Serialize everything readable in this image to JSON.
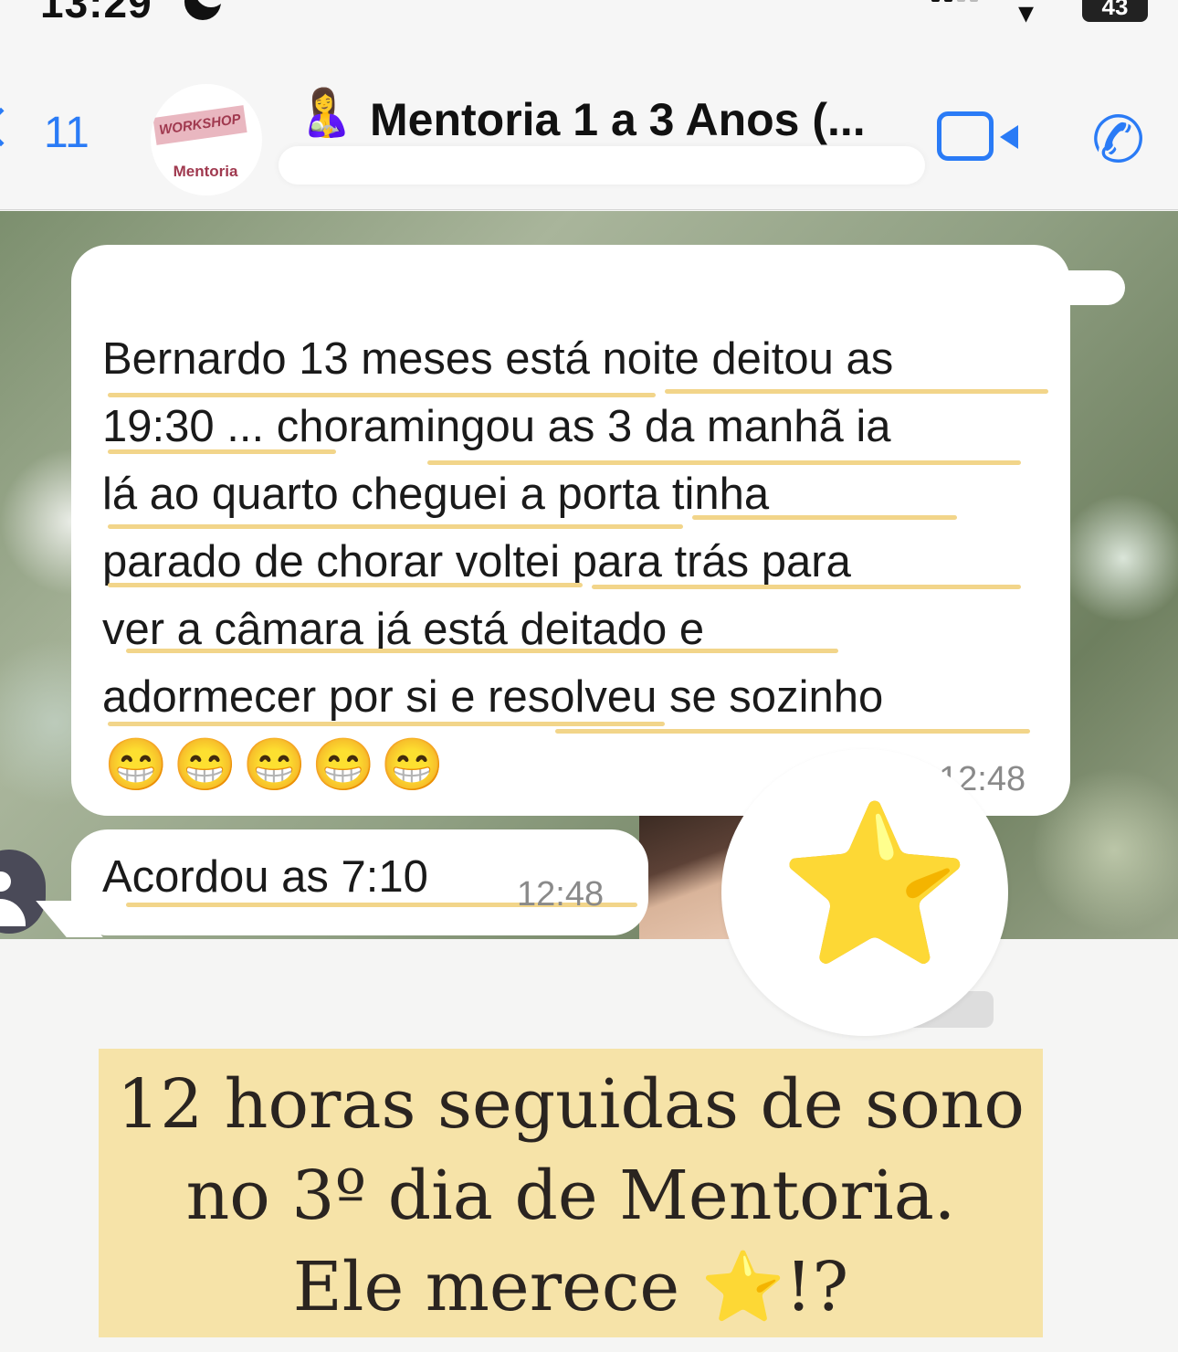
{
  "status_bar": {
    "time": "13:29",
    "battery": "43"
  },
  "header": {
    "back_count": "11",
    "avatar_text": "WORKSHOP",
    "avatar_label": "Mentoria",
    "title_emoji": "🤱",
    "title": "Mentoria 1 a 3 Anos (...",
    "icons": [
      "video-icon",
      "phone-icon"
    ]
  },
  "messages": [
    {
      "text_lines": [
        "Bernardo 13 meses está noite deitou as",
        "19:30 ... choramingou as 3 da manhã ia",
        "lá ao quarto cheguei a porta tinha",
        "parado de chorar voltei para trás para",
        "ver a câmara já está deitado e",
        "adormecer por si e resolveu se sozinho"
      ],
      "emojis": "😁😁😁😁😁",
      "time": "12:48"
    },
    {
      "text": "Acordou as 7:10",
      "time": "12:48"
    }
  ],
  "sticker": "⭐",
  "caption": {
    "line1": "12 horas seguidas de sono",
    "line2": "no 3º dia de Mentoria.",
    "line3": "Ele merece ⭐!?"
  },
  "colors": {
    "accent": "#2a7bf6",
    "highlight": "#f2d58a",
    "caption_bg": "#f6e3a8"
  }
}
